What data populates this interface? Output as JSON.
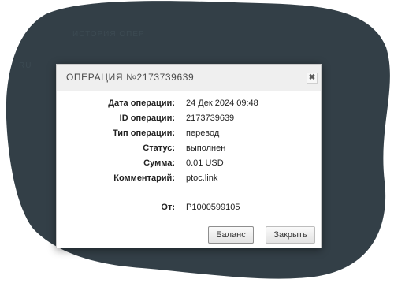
{
  "background": {
    "blob_color": "#333f47",
    "ghost_text_1": "ИСТОРИЯ ОПЕР",
    "ghost_text_2": "RU"
  },
  "modal": {
    "title": "ОПЕРАЦИЯ №2173739639",
    "close_glyph": "✖",
    "fields": [
      {
        "label": "Дата операции:",
        "value": "24 Дек 2024 09:48"
      },
      {
        "label": "ID операции:",
        "value": "2173739639"
      },
      {
        "label": "Тип операции:",
        "value": "перевод"
      },
      {
        "label": "Статус:",
        "value": "выполнен"
      },
      {
        "label": "Сумма:",
        "value": "0.01 USD"
      },
      {
        "label": "Комментарий:",
        "value": "ptoc.link"
      }
    ],
    "from": {
      "label": "От:",
      "value": "P1000599105"
    },
    "buttons": {
      "balance": "Баланс",
      "close": "Закрыть"
    }
  }
}
